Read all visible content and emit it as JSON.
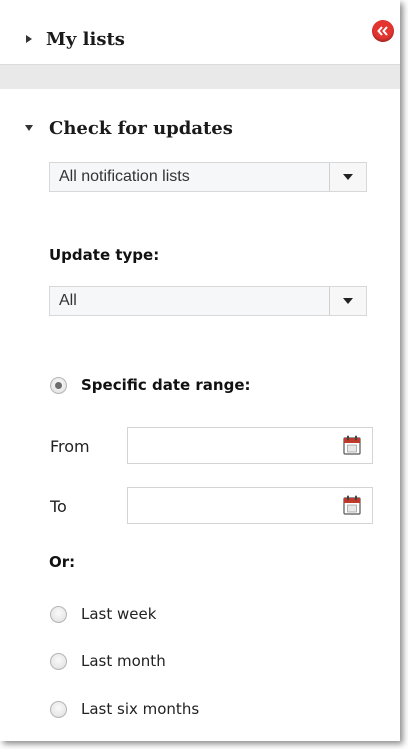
{
  "panel": {
    "my_lists": {
      "label": "My lists",
      "expanded": false
    },
    "collapse_button": {
      "icon": "double-chevron-left-icon",
      "color": "#e3342f"
    },
    "check_updates": {
      "label": "Check for updates",
      "expanded": true,
      "notification_select": {
        "value": "All notification lists"
      },
      "update_type": {
        "label": "Update type:",
        "value": "All"
      },
      "specific_range": {
        "label": "Specific date range:",
        "selected": true,
        "from": {
          "label": "From",
          "value": "",
          "icon": "calendar-icon"
        },
        "to": {
          "label": "To",
          "value": "",
          "icon": "calendar-icon"
        }
      },
      "or_label": "Or:",
      "presets": [
        {
          "label": "Last week",
          "selected": false
        },
        {
          "label": "Last month",
          "selected": false
        },
        {
          "label": "Last six months",
          "selected": false
        }
      ]
    }
  }
}
